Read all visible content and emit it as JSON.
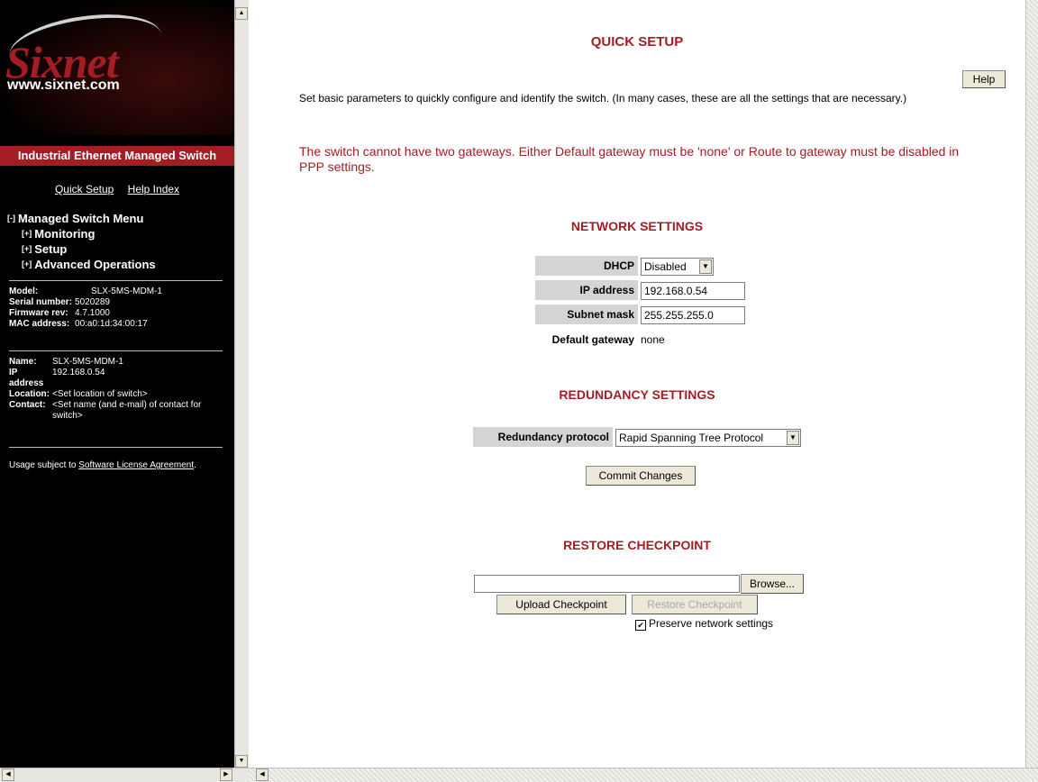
{
  "sidebar": {
    "logo_text": "Sixnet",
    "logo_url": "www.sixnet.com",
    "product": "Industrial Ethernet Managed Switch",
    "quick_setup": "Quick Setup",
    "help_index": "Help Index",
    "menu": {
      "root_toggle": "[-]",
      "root": "Managed Switch Menu",
      "items": [
        {
          "toggle": "[+]",
          "label": "Monitoring"
        },
        {
          "toggle": "[+]",
          "label": "Setup"
        },
        {
          "toggle": "[+]",
          "label": "Advanced Operations"
        }
      ]
    },
    "device": {
      "model_label": "Model:",
      "model": "SLX-5MS-MDM-1",
      "serial_label": "Serial number:",
      "serial": "5020289",
      "firmware_label": "Firmware rev:",
      "firmware": "4.7.1000",
      "mac_label": "MAC address:",
      "mac": "00:a0:1d:34:00:17"
    },
    "identity": {
      "name_label": "Name:",
      "name": "SLX-5MS-MDM-1",
      "ip_label": "IP address",
      "ip": "192.168.0.54",
      "location_label": "Location:",
      "location": "<Set location of switch>",
      "contact_label": "Contact:",
      "contact": "<Set name (and e-mail) of contact for switch>"
    },
    "usage_prefix": "Usage subject to ",
    "usage_link": "Software License Agreement",
    "usage_suffix": "."
  },
  "main": {
    "title": "QUICK SETUP",
    "help": "Help",
    "intro": "Set basic parameters to quickly configure and identify the switch. (In many cases, these are all the settings that are necessary.)",
    "error": "The switch cannot have two gateways. Either Default gateway must be 'none' or Route to gateway must be disabled in PPP settings.",
    "network": {
      "heading": "NETWORK SETTINGS",
      "dhcp_label": "DHCP",
      "dhcp_value": "Disabled",
      "ip_label": "IP address",
      "ip_value": "192.168.0.54",
      "mask_label": "Subnet mask",
      "mask_value": "255.255.255.0",
      "gateway_label": "Default gateway",
      "gateway_value": "none"
    },
    "redundancy": {
      "heading": "REDUNDANCY SETTINGS",
      "protocol_label": "Redundancy protocol",
      "protocol_value": "Rapid Spanning Tree Protocol",
      "commit": "Commit Changes"
    },
    "restore": {
      "heading": "RESTORE CHECKPOINT",
      "file_value": "",
      "browse": "Browse...",
      "upload": "Upload Checkpoint",
      "restore": "Restore Checkpoint",
      "preserve_label": "Preserve network settings",
      "preserve_checked": true
    }
  }
}
